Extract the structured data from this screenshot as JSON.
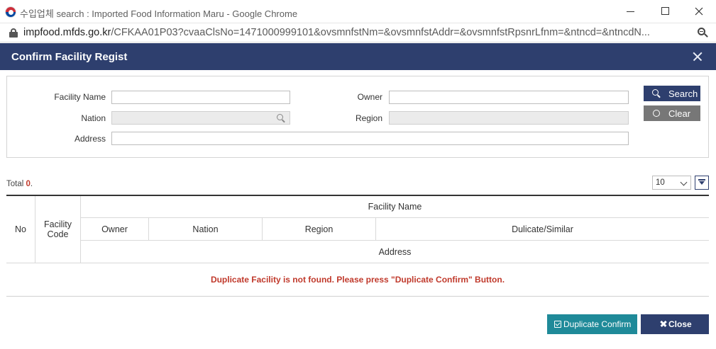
{
  "window": {
    "title": "수입업체 search : Imported Food Information Maru - Google Chrome"
  },
  "addressbar": {
    "domain": "impfood.mfds.go.kr",
    "path": "/CFKAA01P03?cvaaClsNo=1471000999101&ovsmnfstNm=&ovsmnfstAddr=&ovsmnfstRpsnrLfnm=&ntncd=&ntncdN..."
  },
  "dialog": {
    "title": "Confirm Facility Regist"
  },
  "search": {
    "facility_name_label": "Facility Name",
    "facility_name_value": "",
    "owner_label": "Owner",
    "owner_value": "",
    "nation_label": "Nation",
    "nation_value": "",
    "region_label": "Region",
    "region_value": "",
    "address_label": "Address",
    "address_value": "",
    "search_button": "Search",
    "clear_button": "Clear"
  },
  "results": {
    "total_label": "Total",
    "total_count": "0",
    "total_suffix": ".",
    "page_size": "10"
  },
  "table": {
    "headers": {
      "no": "No",
      "facility_code": "Facility Code",
      "facility_name": "Facility Name",
      "owner": "Owner",
      "nation": "Nation",
      "region": "Region",
      "duplicate": "Dulicate/Similar",
      "address": "Address"
    },
    "empty_message": "Duplicate Facility is not found. Please press \"Duplicate Confirm\" Button."
  },
  "footer": {
    "duplicate_confirm_button": "Duplicate Confirm",
    "close_button": "Close"
  },
  "colors": {
    "header_navy": "#2e3f6e",
    "teal_button": "#1f8a99",
    "gray_button": "#777777",
    "alert_red": "#c0392b"
  }
}
